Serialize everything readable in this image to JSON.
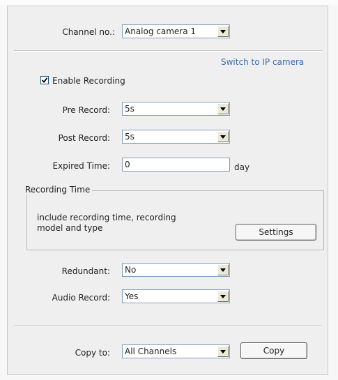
{
  "channel": {
    "label": "Channel no.:",
    "value": "Analog camera 1"
  },
  "switch_link": "Switch to IP camera",
  "enable_recording": {
    "label": "Enable Recording",
    "checked": true
  },
  "pre_record": {
    "label": "Pre Record:",
    "value": "5s"
  },
  "post_record": {
    "label": "Post Record:",
    "value": "5s"
  },
  "expired_time": {
    "label": "Expired Time:",
    "value": "0",
    "unit": "day"
  },
  "recording_time": {
    "legend": "Recording Time",
    "desc_line1": "include recording time, recording",
    "desc_line2": "model and type",
    "settings_label": "Settings"
  },
  "redundant": {
    "label": "Redundant:",
    "value": "No"
  },
  "audio_record": {
    "label": "Audio Record:",
    "value": "Yes"
  },
  "copy_to": {
    "label": "Copy to:",
    "value": "All Channels",
    "copy_label": "Copy"
  },
  "colors": {
    "link": "#3d6fb4",
    "field_border": "#7f9db9",
    "panel_bg": "#efefef"
  }
}
